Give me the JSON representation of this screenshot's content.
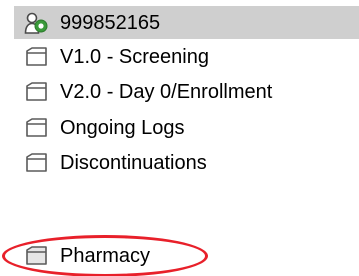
{
  "colors": {
    "selected_row_bg": "#cfcfcf",
    "callout_ellipse": "#e8202a",
    "folder_stroke": "#5a5a5a",
    "folder_fill": "#ffffff",
    "subject_icon_green": "#3a9a3a"
  },
  "tree": {
    "items": [
      {
        "label": "999852165",
        "icon": "subject-person-icon",
        "selected": true
      },
      {
        "label": "V1.0 - Screening",
        "icon": "folder-icon",
        "selected": false
      },
      {
        "label": "V2.0 - Day 0/Enrollment",
        "icon": "folder-icon",
        "selected": false
      },
      {
        "label": "Ongoing Logs",
        "icon": "folder-icon",
        "selected": false
      },
      {
        "label": "Discontinuations",
        "icon": "folder-icon",
        "selected": false
      },
      {
        "label": "Pharmacy",
        "icon": "folder-icon",
        "selected": false,
        "highlighted": true
      }
    ]
  }
}
